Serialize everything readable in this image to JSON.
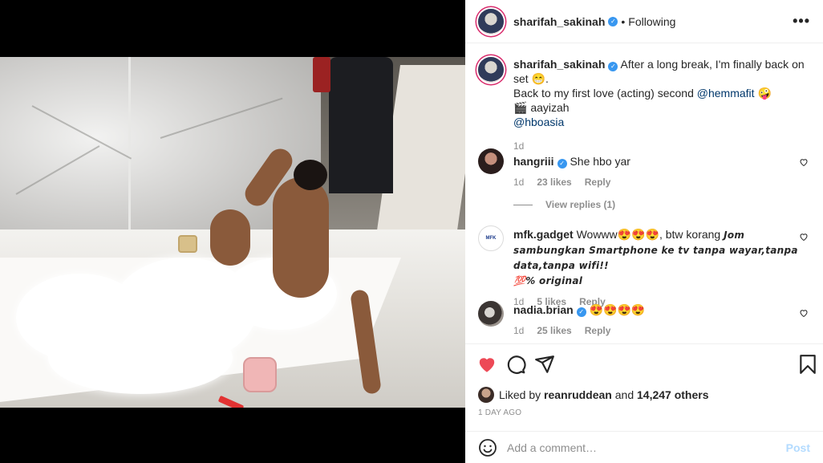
{
  "post": {
    "username": "sharifah_sakinah",
    "follow_status": "Following",
    "separator": "•",
    "more_label": "•••",
    "verified_mark": "✓"
  },
  "caption": {
    "username": "sharifah_sakinah",
    "line1": "After a long break, I'm finally back on set 😁.",
    "line2_prefix": "Back to my first love (acting) second ",
    "line2_mention": "@hemmafit",
    "line2_suffix": " 🤪",
    "line3": "🎬 aayizah",
    "line4_mention": "@hboasia",
    "time": "1d"
  },
  "comments": [
    {
      "username": "hangriii",
      "text": "She hbo yar",
      "time": "1d",
      "likes": "23 likes",
      "reply": "Reply"
    },
    {
      "username": "mfk.gadget",
      "text_plain": "Wowww😍😍😍, btw korang ",
      "text_styled_1": "Jom sambungkan Smartphone ke tv tanpa wayar,tanpa data,tanpa wifi!!",
      "text_styled_2": "💯% original",
      "time": "1d",
      "likes": "5 likes",
      "reply": "Reply",
      "avatar_text": "MFK"
    },
    {
      "username": "nadia.brian",
      "text": "😍😍😍😍",
      "time": "1d",
      "likes": "25 likes",
      "reply": "Reply"
    }
  ],
  "view_replies": "View replies (1)",
  "likes": {
    "prefix": "Liked by ",
    "user": "reanruddean",
    "middle": " and ",
    "others": "14,247 others"
  },
  "timestamp": "1 DAY AGO",
  "add_comment": {
    "placeholder": "Add a comment…",
    "post_label": "Post"
  },
  "colors": {
    "accent_blue": "#3897f0",
    "like_red": "#ed4956",
    "link": "#00376b",
    "muted": "#8e8e8e"
  },
  "icons": [
    "more-icon",
    "verified-icon",
    "heart-icon",
    "comment-icon",
    "share-icon",
    "bookmark-icon",
    "emoji-icon"
  ]
}
